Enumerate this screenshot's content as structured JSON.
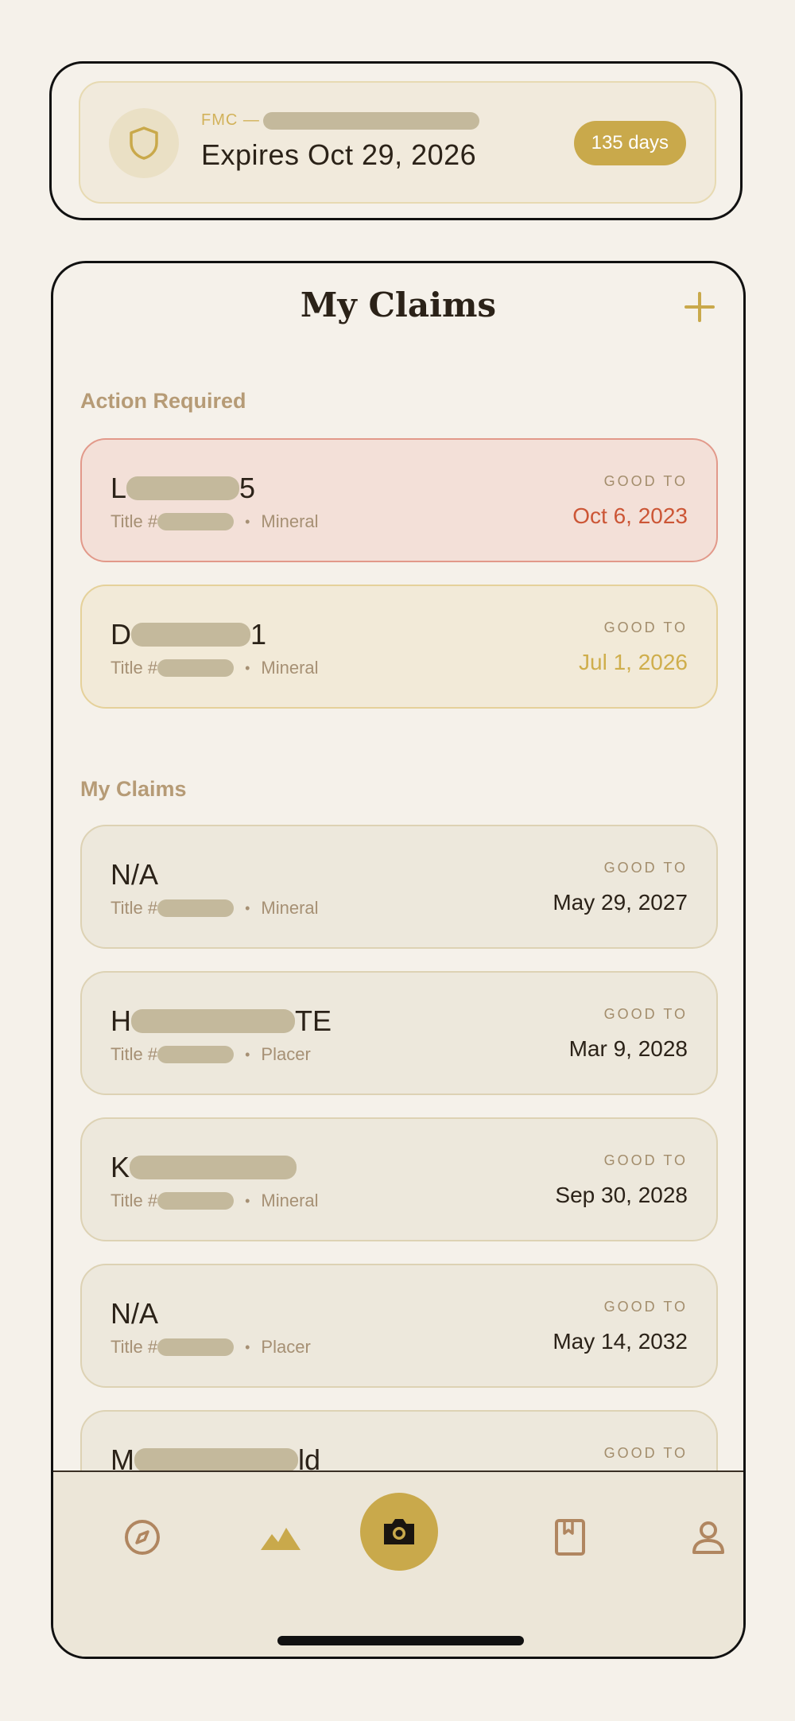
{
  "fmc": {
    "label": "FMC —",
    "expires": "Expires Oct 29, 2026",
    "badge": "135 days"
  },
  "header": {
    "title": "My Claims"
  },
  "sections": {
    "action_required": "Action Required",
    "my_claims": "My Claims"
  },
  "claims": [
    {
      "name_prefix": "L",
      "name_suffix": "5",
      "title_prefix": "Title #",
      "type": "Mineral",
      "good_to": "GOOD TO",
      "date": "Oct 6, 2023",
      "status": "overdue"
    },
    {
      "name_prefix": "D",
      "name_suffix": "1",
      "title_prefix": "Title #",
      "type": "Mineral",
      "good_to": "GOOD TO",
      "date": "Jul 1, 2026",
      "status": "warning"
    },
    {
      "name_prefix": "N/A",
      "name_suffix": "",
      "title_prefix": "Title #",
      "type": "Mineral",
      "good_to": "GOOD TO",
      "date": "May 29, 2027",
      "status": "ok"
    },
    {
      "name_prefix": "H",
      "name_suffix": "TE",
      "title_prefix": "Title #",
      "type": "Placer",
      "good_to": "GOOD TO",
      "date": "Mar 9, 2028",
      "status": "ok"
    },
    {
      "name_prefix": "K",
      "name_suffix": "",
      "title_prefix": "Title #",
      "type": "Mineral",
      "good_to": "GOOD TO",
      "date": "Sep 30, 2028",
      "status": "ok"
    },
    {
      "name_prefix": "N/A",
      "name_suffix": "",
      "title_prefix": "Title #",
      "type": "Placer",
      "good_to": "GOOD TO",
      "date": "May 14, 2032",
      "status": "ok"
    },
    {
      "name_prefix": "M",
      "name_suffix": "ld",
      "good_to": "GOOD TO",
      "status": "ok"
    }
  ],
  "nav": {
    "items": [
      "compass-icon",
      "mountains-icon",
      "camera-icon",
      "bookmark-icon",
      "profile-icon"
    ]
  },
  "colors": {
    "accent": "#C9A94B",
    "overdue": "#CC5636",
    "warning": "#CFAE4C",
    "text": "#2B2218"
  }
}
